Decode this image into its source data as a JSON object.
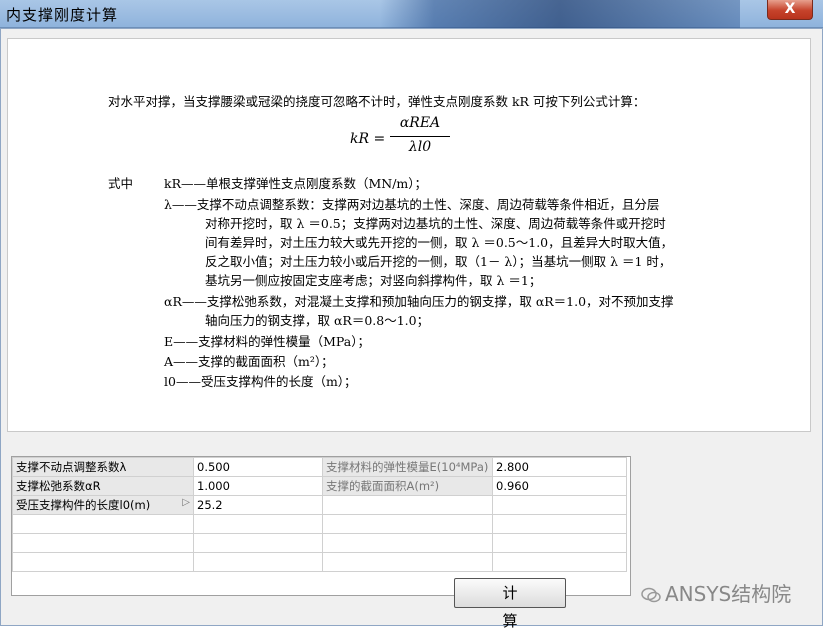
{
  "window": {
    "title": "内支撑刚度计算",
    "close_label": "X"
  },
  "doc": {
    "intro": "对水平对撑，当支撑腰梁或冠梁的挠度可忽略不计时，弹性支点刚度系数 kR 可按下列公式计算：",
    "formula_lhs": "kR =",
    "formula_num": "αREA",
    "formula_den": "λl0",
    "label_shizhong": "式中",
    "lines": [
      "kR——单根支撑弹性支点刚度系数（MN/m）；",
      "λ——支撑不动点调整系数：支撑两对边基坑的土性、深度、周边荷载等条件相近，且分层",
      "对称开挖时，取 λ ＝0.5；支撑两对边基坑的土性、深度、周边荷载等条件或开挖时",
      "间有差异时，对土压力较大或先开挖的一侧，取 λ ＝0.5～1.0，且差异大时取大值，",
      "反之取小值；对土压力较小或后开挖的一侧，取（1－ λ）；当基坑一侧取 λ ＝1 时，",
      "基坑另一侧应按固定支座考虑；对竖向斜撑构件，取 λ ＝1；",
      "αR——支撑松弛系数，对混凝土支撑和预加轴向压力的钢支撑，取 αR＝1.0，对不预加支撑",
      "轴向压力的钢支撑，取 αR＝0.8～1.0；",
      "E——支撑材料的弹性模量（MPa）；",
      "A——支撑的截面面积（m²）；",
      "l0——受压支撑构件的长度（m）；"
    ]
  },
  "params": {
    "rows": [
      {
        "label1": "支撑不动点调整系数λ",
        "value1": "0.500",
        "label2": "支撑材料的弹性模量E(10⁴MPa)",
        "value2": "2.800"
      },
      {
        "label1": "支撑松弛系数αR",
        "value1": "1.000",
        "label2": "支撑的截面面积A(m²)",
        "value2": "0.960"
      },
      {
        "label1": "受压支撑构件的长度l0(m)",
        "value1": "25.2",
        "label2": "",
        "value2": ""
      }
    ]
  },
  "actions": {
    "calc_label": "计算"
  },
  "watermark": {
    "text": "ANSYS结构院"
  }
}
